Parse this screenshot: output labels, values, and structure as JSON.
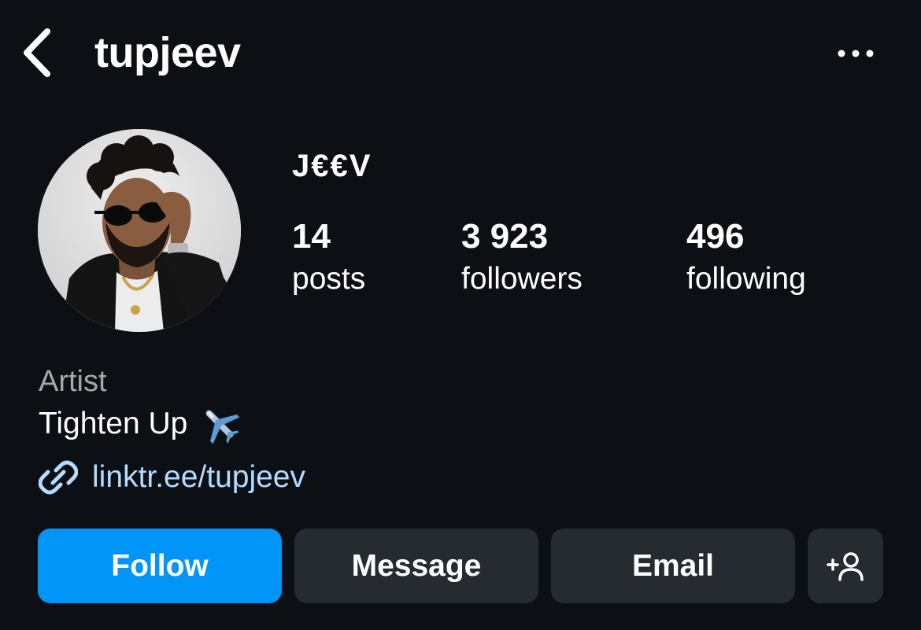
{
  "header": {
    "username": "tupjeev",
    "back_icon": "chevron-left-icon",
    "more_icon": "ellipsis-icon"
  },
  "profile": {
    "display_name": "J€€V",
    "stats": {
      "posts": {
        "count": "14",
        "label": "posts"
      },
      "followers": {
        "count": "3 923",
        "label": "followers"
      },
      "following": {
        "count": "496",
        "label": "following"
      }
    },
    "category": "Artist",
    "bio": "Tighten Up",
    "bio_emoji": "airplane-emoji",
    "link": "linktr.ee/tupjeev",
    "link_icon": "link-icon"
  },
  "actions": {
    "follow_label": "Follow",
    "message_label": "Message",
    "email_label": "Email",
    "add_user_icon": "add-user-icon"
  },
  "colors": {
    "background": "#0c1014",
    "primary_button": "#0095f6",
    "secondary_button": "#262a31",
    "link": "#b3dbff",
    "muted_text": "#a8a8a8"
  }
}
